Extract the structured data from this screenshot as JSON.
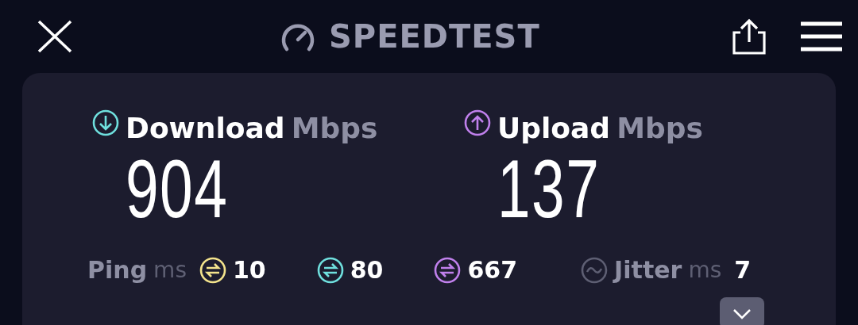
{
  "header": {
    "title": "SPEEDTEST"
  },
  "tests": [
    {
      "kind": "download",
      "label": "Download",
      "unit": "Mbps",
      "value": "904",
      "color": "#6fe0de"
    },
    {
      "kind": "upload",
      "label": "Upload",
      "unit": "Mbps",
      "value": "137",
      "color": "#c080ec"
    }
  ],
  "ping": {
    "label": "Ping",
    "unit": "ms",
    "items": [
      {
        "value": "10",
        "color": "#f3e38c"
      },
      {
        "value": "80",
        "color": "#6fe0de"
      },
      {
        "value": "667",
        "color": "#c080ec"
      }
    ]
  },
  "jitter": {
    "label": "Jitter",
    "unit": "ms",
    "value": "7"
  }
}
